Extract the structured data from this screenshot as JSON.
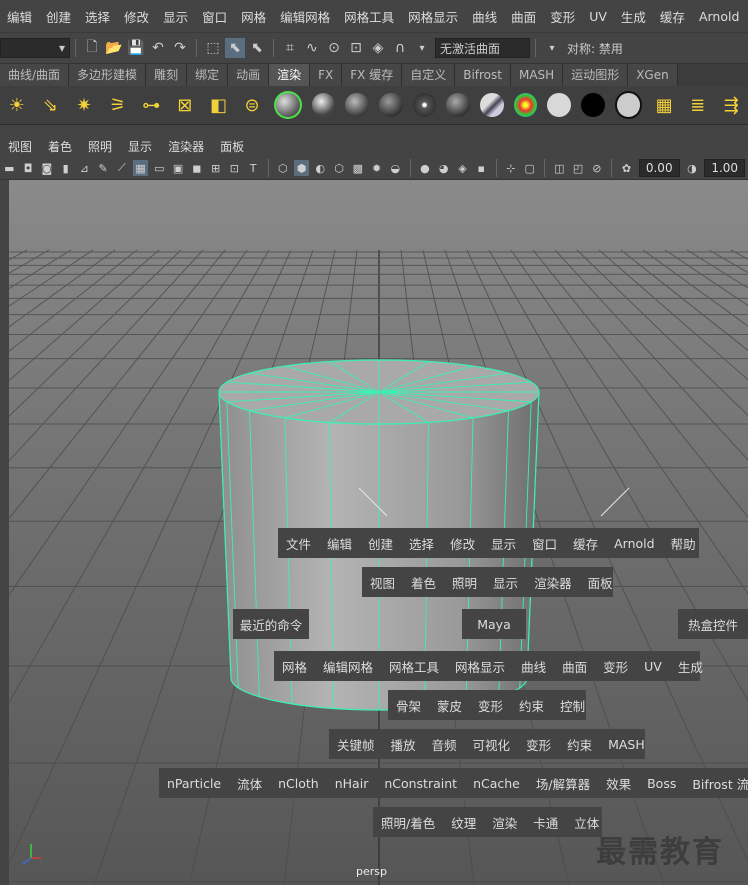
{
  "menubar": [
    "编辑",
    "创建",
    "选择",
    "修改",
    "显示",
    "窗口",
    "网格",
    "编辑网格",
    "网格工具",
    "网格显示",
    "曲线",
    "曲面",
    "变形",
    "UV",
    "生成",
    "缓存",
    "Arnold"
  ],
  "status": {
    "live_surface": "无激活曲面",
    "symmetry": "对称: 禁用"
  },
  "shelf_tabs": [
    "曲线/曲面",
    "多边形建模",
    "雕刻",
    "绑定",
    "动画",
    "渲染",
    "FX",
    "FX 缓存",
    "自定义",
    "Bifrost",
    "MASH",
    "运动图形",
    "XGen"
  ],
  "shelf_active_tab": "渲染",
  "panel_menu": [
    "视图",
    "着色",
    "照明",
    "显示",
    "渲染器",
    "面板"
  ],
  "panel_fields": {
    "exposure": "0.00",
    "gamma": "1.00"
  },
  "camera": "persp",
  "hotbox": {
    "main_menus": [
      "文件",
      "编辑",
      "创建",
      "选择",
      "修改",
      "显示",
      "窗口",
      "缓存",
      "Arnold",
      "帮助"
    ],
    "panel_menus": [
      "视图",
      "着色",
      "照明",
      "显示",
      "渲染器",
      "面板"
    ],
    "recent": "最近的命令",
    "center": "Maya",
    "hotbox_controls": "热盒控件",
    "modeling_menus": [
      "网格",
      "编辑网格",
      "网格工具",
      "网格显示",
      "曲线",
      "曲面",
      "变形",
      "UV",
      "生成"
    ],
    "rigging_menus": [
      "骨架",
      "蒙皮",
      "变形",
      "约束",
      "控制"
    ],
    "animation_menus": [
      "关键帧",
      "播放",
      "音频",
      "可视化",
      "变形",
      "约束",
      "MASH"
    ],
    "fx_menus": [
      "nParticle",
      "流体",
      "nCloth",
      "nHair",
      "nConstraint",
      "nCache",
      "场/解算器",
      "效果",
      "Boss",
      "Bifrost 流体"
    ],
    "rendering_menus": [
      "照明/着色",
      "纹理",
      "渲染",
      "卡通",
      "立体"
    ]
  },
  "watermark": "最需教育",
  "colors": {
    "wireframe": "#3cf0b4",
    "panel": "#444444",
    "viewport_bg": "#6c6c6c"
  }
}
